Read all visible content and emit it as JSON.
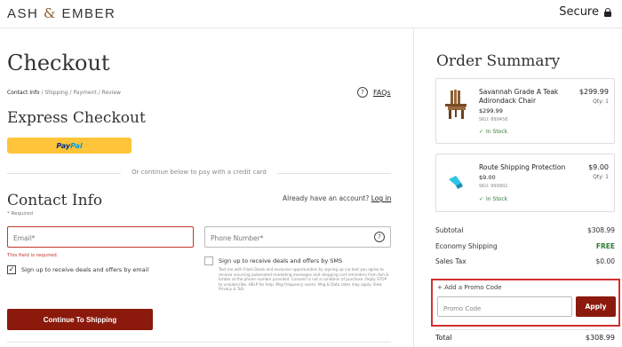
{
  "header": {
    "logo_left": "ASH",
    "logo_amp": "&",
    "logo_right": "EMBER",
    "secure_label": "Secure",
    "secure_icon": "lock-icon"
  },
  "checkout": {
    "title": "Checkout",
    "breadcrumb": {
      "active": "Contact Info",
      "rest": " / Shipping / Payment / Review"
    },
    "faqs_label": "FAQs",
    "express_title": "Express Checkout",
    "paypal": {
      "pay": "Pay",
      "pal": "Pal"
    },
    "divider_text": "Or continue below to pay with a credit card",
    "contact_title": "Contact Info",
    "required_note": "* Required",
    "account_prompt": "Already have an account?",
    "login_label": "Log in",
    "email_placeholder": "Email*",
    "email_error": "This field is required.",
    "phone_placeholder": "Phone Number*",
    "email_optin_label": "Sign up to receive deals and offers by email",
    "email_optin_checked": true,
    "sms_optin_label": "Sign up to receive deals and offers by SMS",
    "sms_optin_checked": false,
    "sms_fine_print": "Text me with Flash Deals and exclusive opportunities by signing up via text you agree to receive recurring automated marketing messages and shopping cart reminders from Ash & Ember at the phone number provided. Consent is not a condition of purchase. Reply STOP to unsubscribe. HELP for help. Msg frequency varies. Msg & Data rates may apply. View Privacy & ToS.",
    "continue_label": "Continue To Shipping"
  },
  "summary": {
    "title": "Order Summary",
    "items": [
      {
        "name": "Savannah Grade A Teak Adirondack Chair",
        "price": "$299.99",
        "sku": "SKU: 899458",
        "stock": "In Stock",
        "total": "$299.99",
        "qty": "Qty: 1",
        "thumb_icon": "adirondack-chair-icon"
      },
      {
        "name": "Route Shipping Protection",
        "price": "$9.00",
        "sku": "SKU: 999902",
        "stock": "In Stock",
        "total": "$9.00",
        "qty": "Qty: 1",
        "thumb_icon": "route-logo-icon"
      }
    ],
    "subtotal_label": "Subtotal",
    "subtotal_value": "$308.99",
    "shipping_label": "Economy Shipping",
    "shipping_value": "FREE",
    "tax_label": "Sales Tax",
    "tax_value": "$0.00",
    "promo_toggle": "+ Add a Promo Code",
    "promo_placeholder": "Promo Code",
    "apply_label": "Apply",
    "total_label": "Total",
    "total_value": "$308.99"
  },
  "colors": {
    "brand_button": "#8b1a0c",
    "error": "#c0392b",
    "highlight_border": "#d32f2f",
    "stock_green": "#2e7d32",
    "paypal_yellow": "#ffc439"
  }
}
